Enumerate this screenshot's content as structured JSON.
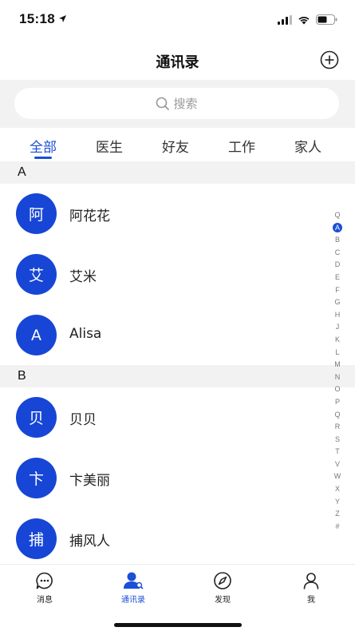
{
  "status": {
    "time": "15:18",
    "icons": [
      "location-arrow-icon",
      "signal-icon",
      "wifi-icon",
      "battery-icon"
    ]
  },
  "header": {
    "title": "通讯录",
    "add_icon": "plus-circle-icon"
  },
  "search": {
    "placeholder": "搜索",
    "icon": "search-icon"
  },
  "tabs": [
    {
      "label": "全部",
      "active": true
    },
    {
      "label": "医生",
      "active": false
    },
    {
      "label": "好友",
      "active": false
    },
    {
      "label": "工作",
      "active": false
    },
    {
      "label": "家人",
      "active": false
    }
  ],
  "sections": [
    {
      "letter": "A",
      "contacts": [
        {
          "avatar": "阿",
          "name": "阿花花"
        },
        {
          "avatar": "艾",
          "name": "艾米"
        },
        {
          "avatar": "A",
          "name": "Alisa"
        }
      ]
    },
    {
      "letter": "B",
      "contacts": [
        {
          "avatar": "贝",
          "name": "贝贝"
        },
        {
          "avatar": "卞",
          "name": "卞美丽"
        },
        {
          "avatar": "捕",
          "name": "捕风人"
        }
      ]
    }
  ],
  "index_letters": [
    "Q",
    "A",
    "B",
    "C",
    "D",
    "E",
    "F",
    "G",
    "H",
    "J",
    "K",
    "L",
    "M",
    "N",
    "O",
    "P",
    "Q",
    "R",
    "S",
    "T",
    "V",
    "W",
    "X",
    "Y",
    "Z",
    "#"
  ],
  "index_active": "A",
  "tabbar": [
    {
      "label": "消息",
      "icon": "chat-bubble-icon",
      "active": false
    },
    {
      "label": "通讯录",
      "icon": "contacts-icon",
      "active": true
    },
    {
      "label": "发现",
      "icon": "compass-icon",
      "active": false
    },
    {
      "label": "我",
      "icon": "person-icon",
      "active": false
    }
  ],
  "colors": {
    "accent": "#1a4fd6",
    "avatar_bg": "#1746d6",
    "section_bg": "#f2f2f2"
  }
}
